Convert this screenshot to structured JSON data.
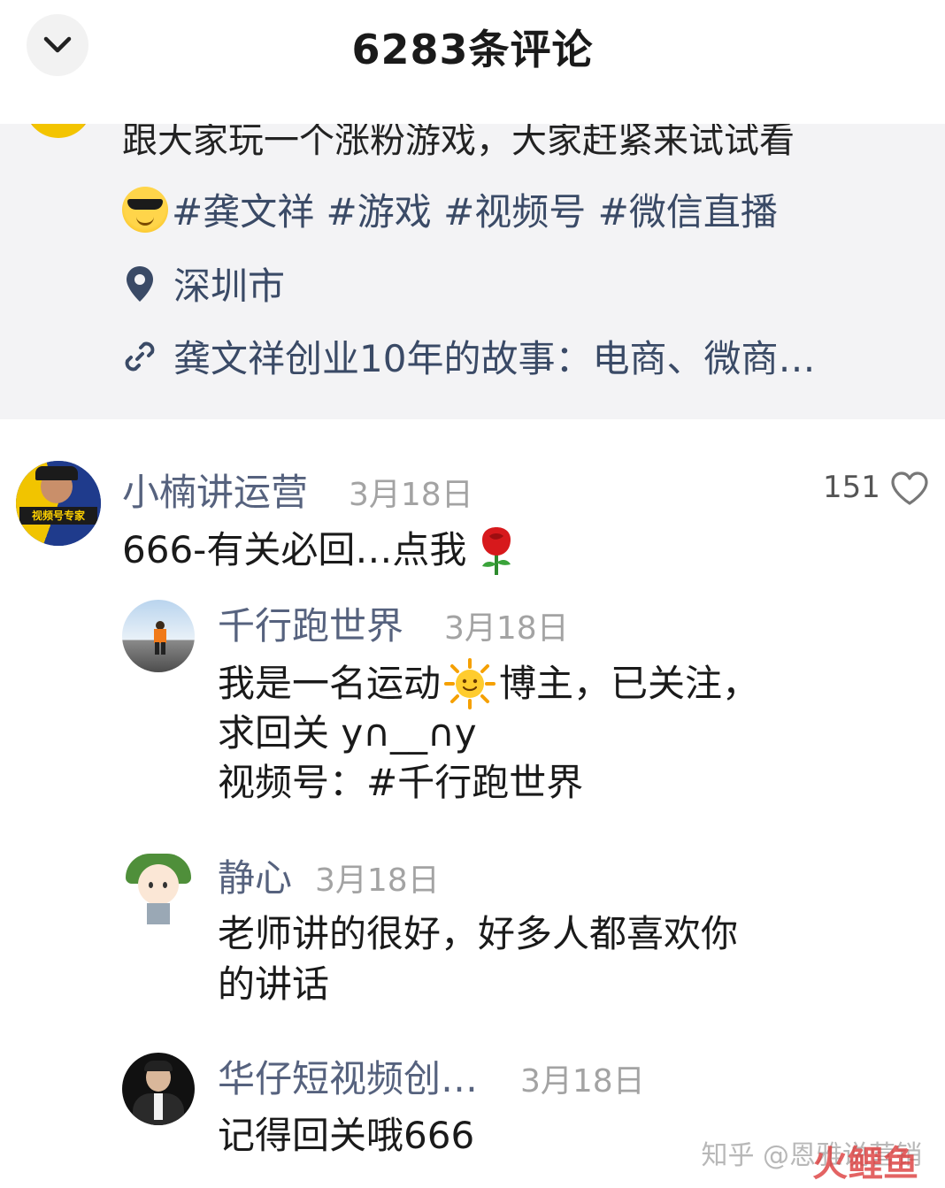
{
  "header": {
    "title": "6283条评论"
  },
  "post": {
    "text_partial": "跟大家玩一个涨粉游戏，大家赶紧来试试看",
    "tags": "#龚文祥 #游戏 #视频号 #微信直播",
    "location": "深圳市",
    "link": "龚文祥创业10年的故事：电商、微商…"
  },
  "comments": [
    {
      "name": "小楠讲运营",
      "date": "3月18日",
      "text": "666-有关必回…点我",
      "likes": "151",
      "avatar_text": "视频号专家"
    },
    {
      "name": "千行跑世界",
      "date": "3月18日",
      "text_lines": [
        "我是一名运动",
        "博主，已关注，",
        "求回关 y∩__∩y",
        "视频号：#千行跑世界"
      ]
    },
    {
      "name": "静心",
      "date": "3月18日",
      "text_lines": [
        "老师讲的很好，好多人都喜欢你",
        "的讲话"
      ]
    },
    {
      "name": "华仔短视频创…",
      "date": "3月18日",
      "text": "记得回关哦666"
    }
  ],
  "watermark": {
    "text": "知乎 @恩雅说营销",
    "logo": "火鲤鱼"
  },
  "colors": {
    "name": "#56627e",
    "date": "#a3a3a3",
    "tag": "#3a4a66",
    "post_bg": "#f3f3f5"
  }
}
